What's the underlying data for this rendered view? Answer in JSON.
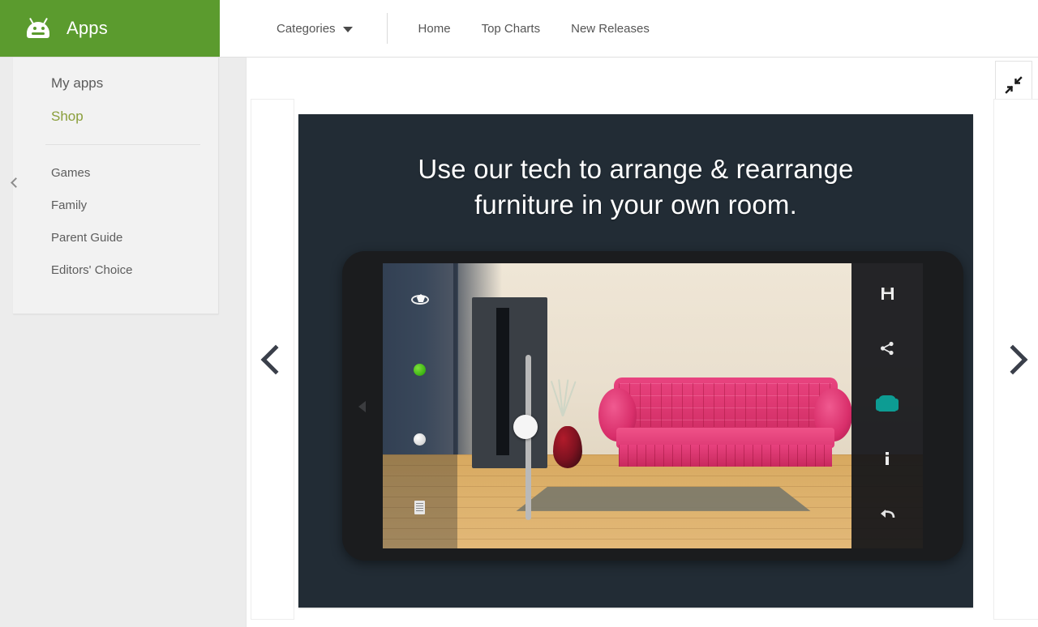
{
  "brand": {
    "label": "Apps",
    "icon": "android-robot-icon",
    "color": "#5b9b2e"
  },
  "nav": {
    "categories_label": "Categories",
    "categories_caret": "chevron-down-icon",
    "links": [
      {
        "label": "Home"
      },
      {
        "label": "Top Charts"
      },
      {
        "label": "New Releases"
      }
    ]
  },
  "sidebar": {
    "collapse_icon": "chevron-left-icon",
    "primary": [
      {
        "label": "My apps",
        "active": false
      },
      {
        "label": "Shop",
        "active": true
      }
    ],
    "secondary": [
      {
        "label": "Games"
      },
      {
        "label": "Family"
      },
      {
        "label": "Parent Guide"
      },
      {
        "label": "Editors' Choice"
      }
    ],
    "active_color": "#8a9e3a"
  },
  "viewer": {
    "collapse_button_icon": "fullscreen-exit-icon",
    "prev_icon": "chevron-left-icon",
    "next_icon": "chevron-right-icon"
  },
  "banner": {
    "headline_line1": "Use our tech to arrange & rearrange",
    "headline_line2": "furniture in your own room.",
    "background_color": "#222c35",
    "text_color": "#ffffff"
  },
  "phone_app": {
    "device": "android-phone",
    "left_toolbar": [
      {
        "icon": "orbit-rotate-icon"
      },
      {
        "icon": "green-marker-icon"
      },
      {
        "icon": "white-marker-icon"
      },
      {
        "icon": "catalog-icon"
      }
    ],
    "right_toolbar": [
      {
        "icon": "save-icon"
      },
      {
        "icon": "share-icon"
      },
      {
        "icon": "armchair-icon",
        "color": "#0d9c93"
      },
      {
        "icon": "info-icon",
        "label": "i"
      },
      {
        "icon": "undo-icon"
      }
    ],
    "scene": {
      "sofa_color": "#e03a74",
      "floor_color": "#dcb06a",
      "wall_color": "#eae0cf",
      "accent_wall_color": "#4a5c73"
    },
    "slider": {
      "handle": "slider-knob"
    }
  }
}
